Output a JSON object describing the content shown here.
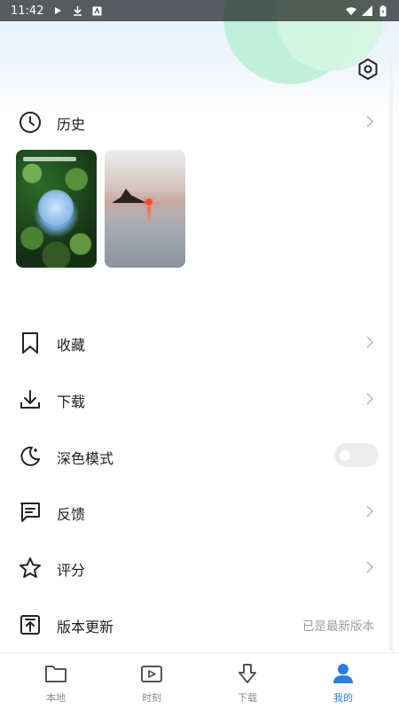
{
  "status_bar": {
    "time": "11:42"
  },
  "history": {
    "label": "历史"
  },
  "menu": {
    "collect": "收藏",
    "download": "下载",
    "dark_mode": "深色模式",
    "feedback": "反馈",
    "rate": "评分",
    "update": "版本更新",
    "update_status": "已是最新版本"
  },
  "dark_mode_enabled": false,
  "tabs": [
    {
      "label": "本地",
      "icon": "folder-icon"
    },
    {
      "label": "时刻",
      "icon": "video-icon"
    },
    {
      "label": "下载",
      "icon": "download-arrow-icon"
    },
    {
      "label": "我的",
      "icon": "person-icon"
    }
  ],
  "active_tab": "我的",
  "colors": {
    "accent": "#2b7ce8",
    "header_green": "#b6efd6",
    "header_blue": "#e3eefb"
  }
}
